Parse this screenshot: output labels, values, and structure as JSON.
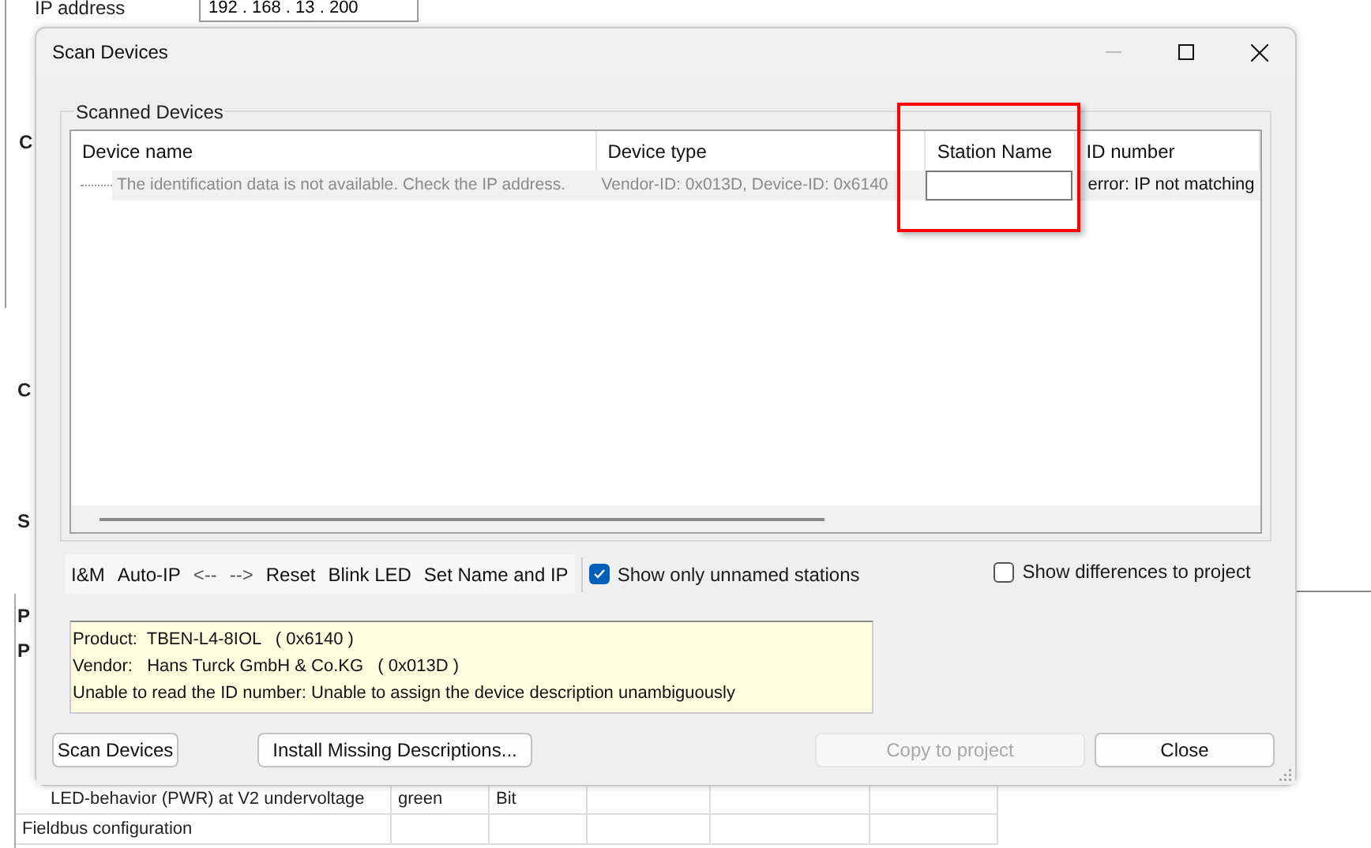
{
  "background": {
    "ip_label": "IP address",
    "ip_address": "192 . 168 . 13 . 200",
    "partial_labels": [
      "C",
      "C",
      "S",
      "P",
      "P"
    ],
    "table_rows": [
      {
        "cells": [
          "LED-behavior (PWR) at V2 undervoltage",
          "green",
          "Bit"
        ],
        "indented": true
      },
      {
        "cells": [
          "Fieldbus configuration",
          "",
          ""
        ],
        "indented": false
      }
    ]
  },
  "dialog": {
    "title": "Scan Devices",
    "group_title": "Scanned Devices",
    "columns": [
      "Device name",
      "Device type",
      "Station Name",
      "ID number"
    ],
    "rows": [
      {
        "device_name": "The identification data is not available. Check the IP address.",
        "device_type": "Vendor-ID: 0x013D, Device-ID: 0x6140",
        "id_number": "error: IP not matching",
        "disabled": true
      }
    ],
    "highlight": {
      "kind": "rectangle"
    },
    "toolbar": [
      "I&M",
      "Auto-IP",
      "<--",
      "-->",
      "Reset",
      "Blink LED",
      "Set Name and IP"
    ],
    "checkboxes": [
      {
        "label": "Show only unnamed stations",
        "checked": true
      },
      {
        "label": "Show differences to project",
        "checked": false
      }
    ],
    "info_lines": [
      "Product:  TBEN-L4-8IOL   ( 0x6140 )",
      "Vendor:   Hans Turck GmbH & Co.KG   ( 0x013D )",
      "Unable to read the ID number: Unable to assign the device description unambiguously"
    ],
    "buttons": [
      {
        "label": "Scan Devices",
        "disabled": false
      },
      {
        "label": "Install Missing Descriptions...",
        "disabled": false
      },
      {
        "label": "Copy to project",
        "disabled": true
      },
      {
        "label": "Close",
        "disabled": false
      }
    ]
  }
}
